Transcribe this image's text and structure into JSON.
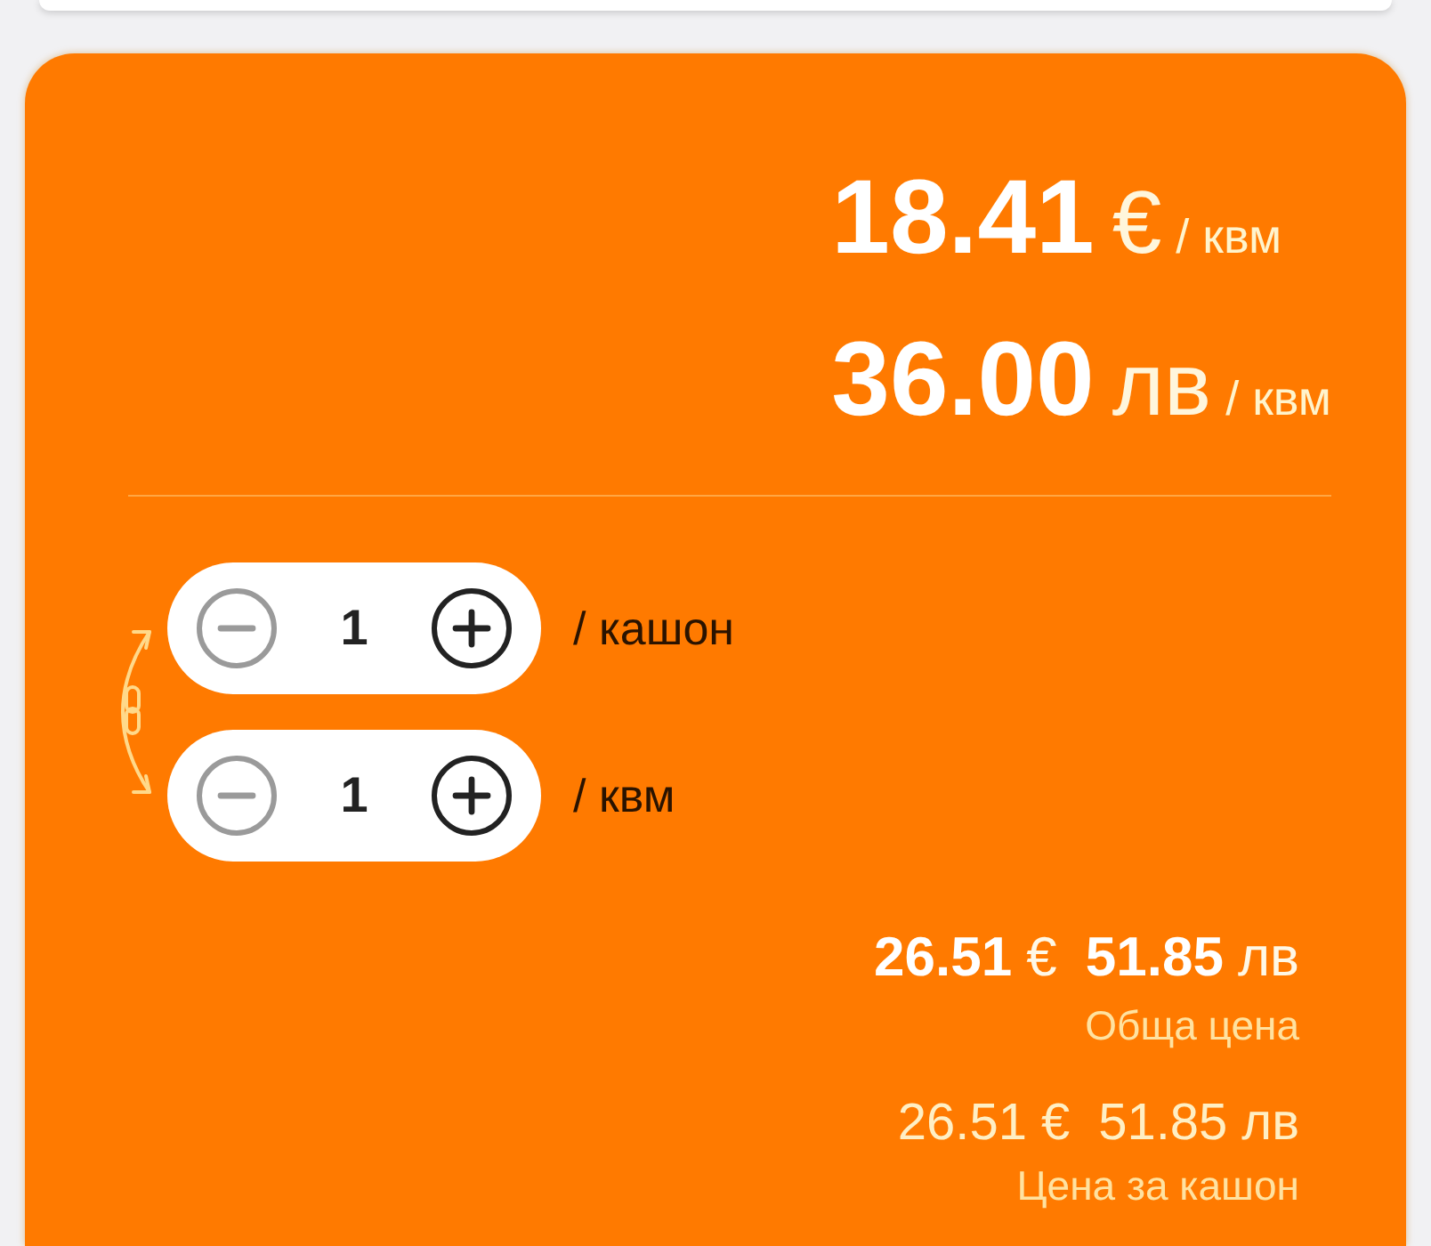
{
  "unit_prices": [
    {
      "amount": "18.41",
      "currency": "€",
      "unit": "/ квм"
    },
    {
      "amount": "36.00",
      "currency": "лв",
      "unit": "/ квм"
    }
  ],
  "steppers": [
    {
      "value": "1",
      "unit": "/ кашон",
      "minus_disabled": true
    },
    {
      "value": "1",
      "unit": "/ квм",
      "minus_disabled": true
    }
  ],
  "totals": [
    {
      "kind": "total",
      "prices": [
        {
          "amount": "26.51",
          "currency": "€"
        },
        {
          "amount": "51.85",
          "currency": "лв"
        }
      ],
      "label": "Обща цена"
    },
    {
      "kind": "per_box",
      "prices": [
        {
          "amount": "26.51",
          "currency": "€"
        },
        {
          "amount": "51.85",
          "currency": "лв"
        }
      ],
      "label": "Цена за кашон"
    }
  ]
}
